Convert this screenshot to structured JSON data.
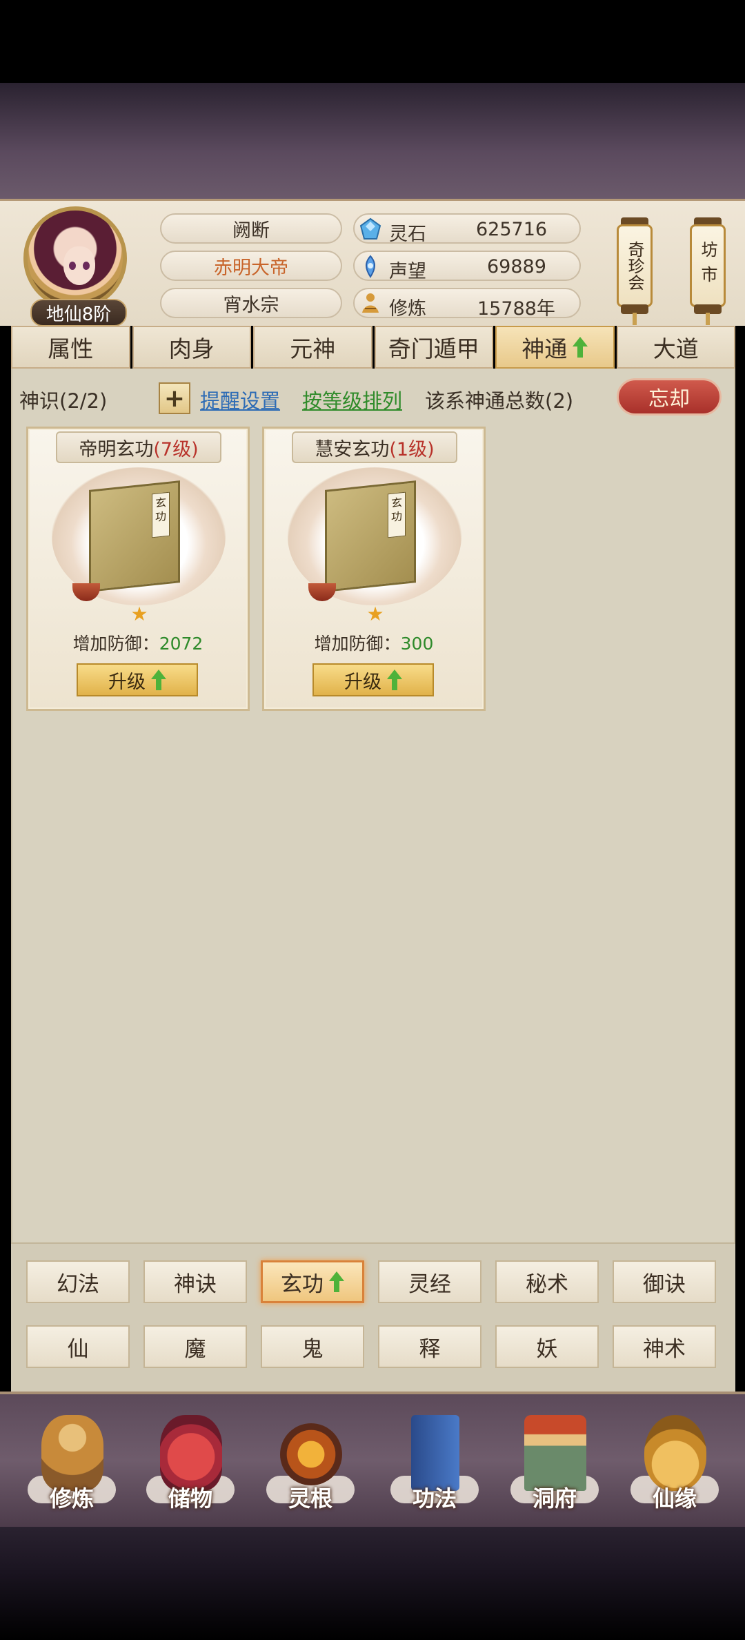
{
  "player": {
    "rank": "地仙8阶",
    "name": "阙断",
    "title": "赤明大帝",
    "sect": "宵水宗"
  },
  "stats": [
    {
      "label": "灵石",
      "value": "625716",
      "icon": "spirit-stone-icon"
    },
    {
      "label": "声望",
      "value": "69889",
      "icon": "reputation-icon"
    },
    {
      "label": "修炼",
      "value": "15788年",
      "icon": "cultivation-icon"
    }
  ],
  "lanterns": [
    {
      "label": "奇珍会"
    },
    {
      "label": "坊市"
    }
  ],
  "tabs": [
    {
      "label": "属性"
    },
    {
      "label": "肉身"
    },
    {
      "label": "元神"
    },
    {
      "label": "奇门遁甲"
    },
    {
      "label": "神通"
    },
    {
      "label": "大道"
    }
  ],
  "active_tab": "神通",
  "toolbar": {
    "capacity": "神识(2/2)",
    "plus": "+",
    "reminder": "提醒设置",
    "sort": "按等级排列",
    "total": "该系神通总数(2)",
    "forget": "忘却"
  },
  "skills": [
    {
      "name": "帝明玄功",
      "level": "(7级)",
      "book_label": "玄功",
      "stat_label": "增加防御：",
      "stat_value": "2072",
      "upgrade": "升级"
    },
    {
      "name": "慧安玄功",
      "level": "(1级)",
      "book_label": "玄功",
      "stat_label": "增加防御：",
      "stat_value": "300",
      "upgrade": "升级"
    }
  ],
  "categories_row1": [
    {
      "label": "幻法"
    },
    {
      "label": "神诀"
    },
    {
      "label": "玄功"
    },
    {
      "label": "灵经"
    },
    {
      "label": "秘术"
    },
    {
      "label": "御诀"
    }
  ],
  "categories_row2": [
    {
      "label": "仙"
    },
    {
      "label": "魔"
    },
    {
      "label": "鬼"
    },
    {
      "label": "释"
    },
    {
      "label": "妖"
    },
    {
      "label": "神术"
    }
  ],
  "active_category": "玄功",
  "nav": [
    {
      "label": "修炼",
      "icon": "monk-icon"
    },
    {
      "label": "储物",
      "icon": "storage-bag-icon"
    },
    {
      "label": "灵根",
      "icon": "spirit-root-icon"
    },
    {
      "label": "功法",
      "icon": "scripture-book-icon"
    },
    {
      "label": "洞府",
      "icon": "cave-house-icon"
    },
    {
      "label": "仙缘",
      "icon": "gourd-icon"
    }
  ],
  "colors": {
    "accent_green": "#4eb23a",
    "level_red": "#b8322a",
    "title_orange": "#c8642a",
    "link_blue": "#2c6bb5",
    "link_green": "#2f8b2a"
  }
}
